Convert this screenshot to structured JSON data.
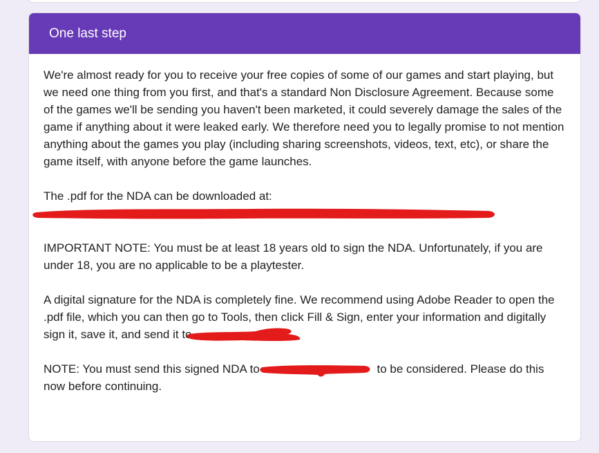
{
  "section": {
    "title": "One last step",
    "paragraphs": {
      "intro": "We're almost ready for you to receive your free copies of some of our games and start playing, but we need one thing from you first, and that's a standard Non Disclosure Agreement. Because some of the games we'll be sending you haven't been marketed, it could severely damage the sales of the game if anything about it were leaked early. We therefore need you to legally promise to not mention anything about the games you play (including sharing screenshots, videos, text, etc), or share the game itself, with anyone before the game launches.",
      "download": "The .pdf for the NDA can be downloaded at:",
      "important": "IMPORTANT NOTE: You must be at least 18 years old to sign the NDA. Unfortunately, if you are under 18, you are no applicable to be a playtester.",
      "signature_prefix": "A digital signature for the NDA is completely fine. We recommend using Adobe Reader to open the .pdf file, which you can then go to Tools, then click Fill & Sign, enter your information and digitally sign it, save it, and send it to",
      "note_prefix": "NOTE: You must send this signed NDA to",
      "note_suffix": " to be considered. Please do this now before continuing."
    }
  },
  "colors": {
    "header_bg": "#673ab7",
    "page_bg": "#efebf7",
    "redaction": "#e31b1b"
  }
}
